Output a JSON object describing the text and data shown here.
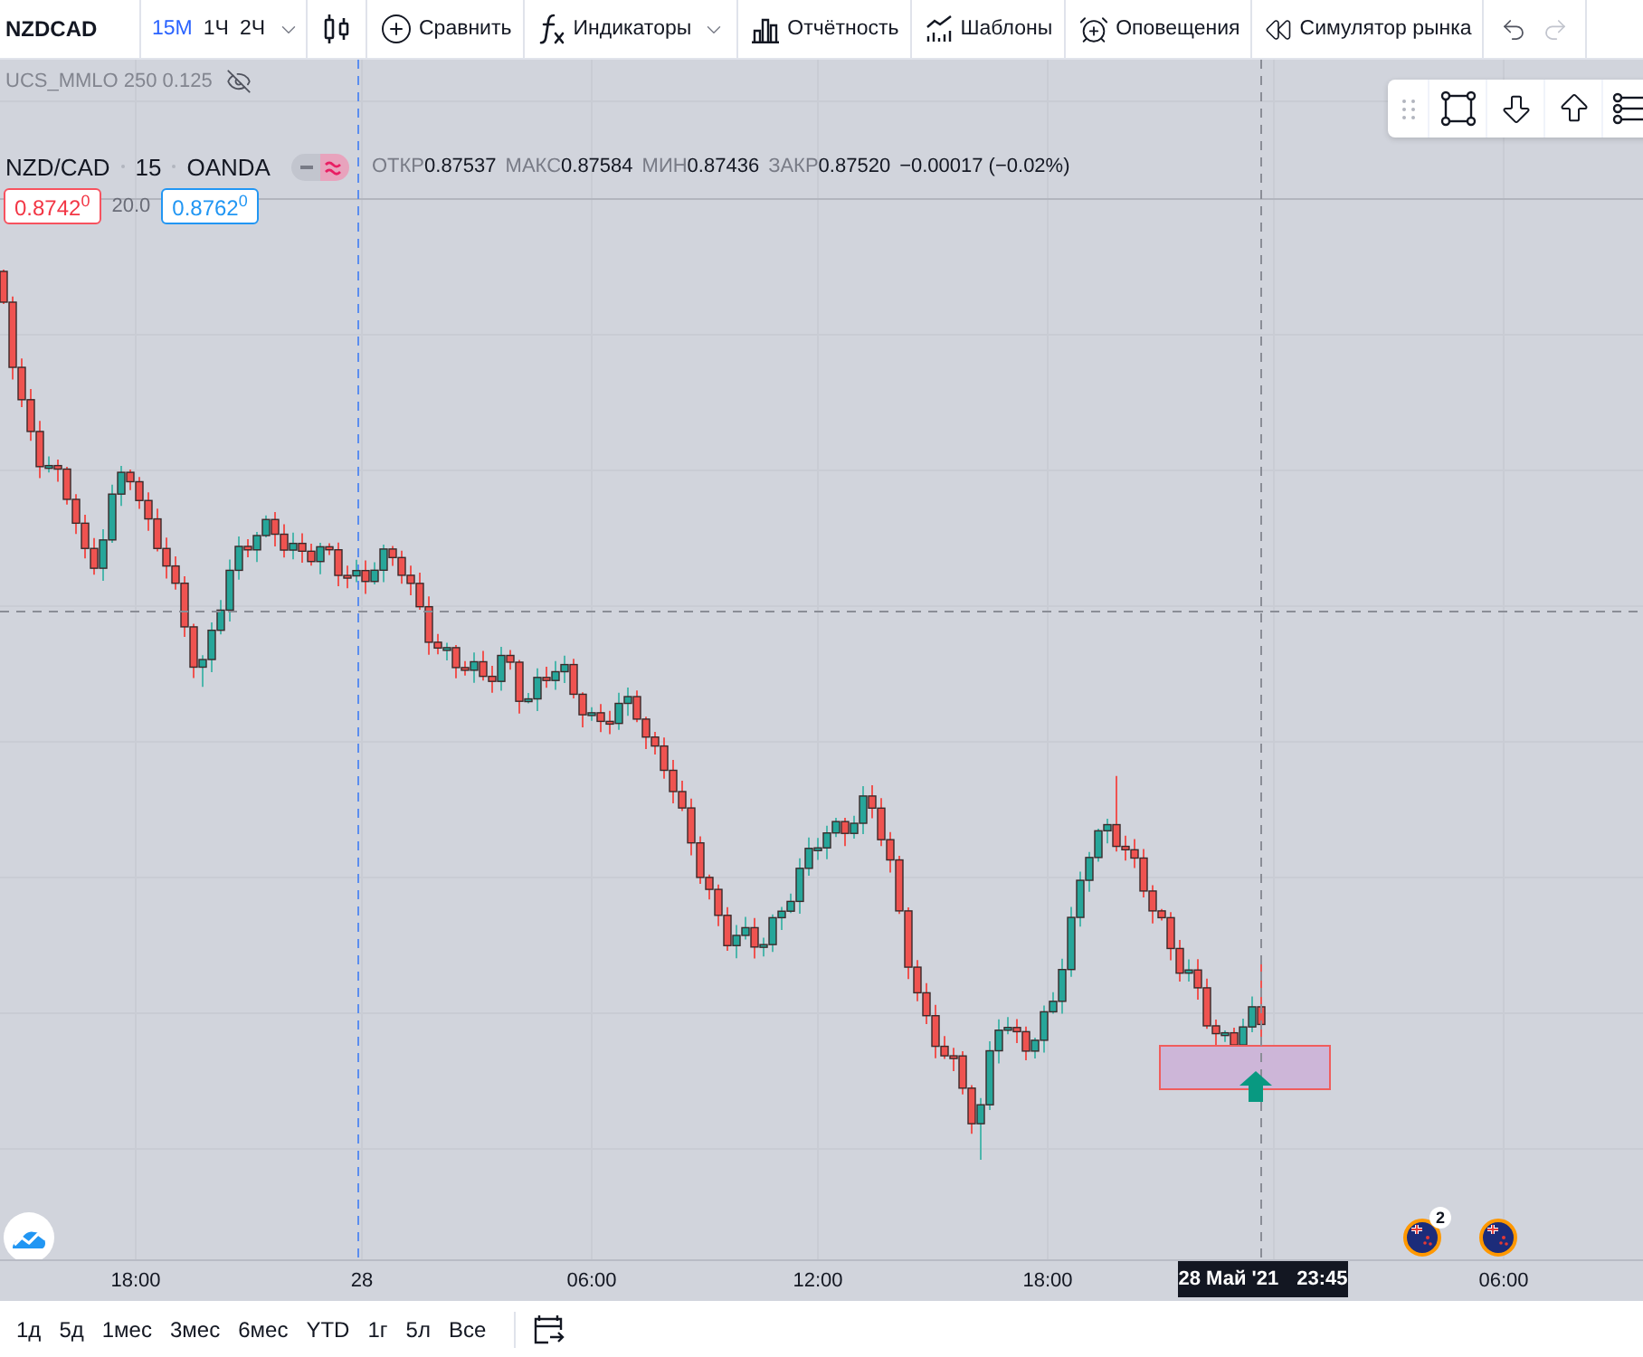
{
  "toolbar": {
    "symbol": "NZDCAD",
    "intervals": [
      {
        "label": "15М",
        "selected": true
      },
      {
        "label": "1Ч",
        "selected": false
      },
      {
        "label": "2Ч",
        "selected": false
      }
    ],
    "buttons": [
      {
        "kind": "compare",
        "label": "Сравнить"
      },
      {
        "kind": "indicators",
        "label": "Индикаторы"
      },
      {
        "kind": "reports",
        "label": "Отчётность"
      },
      {
        "kind": "templates",
        "label": "Шаблоны"
      },
      {
        "kind": "alerts",
        "label": "Оповещения"
      },
      {
        "kind": "replay",
        "label": "Симулятор рынка"
      }
    ],
    "history": [
      {
        "kind": "undo",
        "disabled": false
      },
      {
        "kind": "redo",
        "disabled": true
      }
    ]
  },
  "indicator_pane": {
    "title": "UCS_MMLO 250 0.125",
    "hidden": true
  },
  "legend": {
    "symbol": "NZD/CAD",
    "interval": "15",
    "exchange": "OANDA",
    "ohlc": [
      {
        "label": "ОТКР",
        "value": "0.87537"
      },
      {
        "label": "МАКС",
        "value": "0.87584"
      },
      {
        "label": "МИН",
        "value": "0.87436"
      },
      {
        "label": "ЗАКР",
        "value": "0.87520"
      }
    ],
    "change": "−0.00017 (−0.02%)",
    "sell": "0.8742$^{0}$",
    "spread": "20.0",
    "buy": "0.8762$^{0}$"
  },
  "events": [
    {
      "kind": "grouped",
      "badge": "2"
    },
    {
      "kind": "single"
    }
  ],
  "time_axis": {
    "labels": [
      "18:00",
      "28",
      "06:00",
      "12:00",
      "18:00",
      "06:00"
    ],
    "cursor": {
      "date": "28 Май '21",
      "time": "23:45"
    }
  },
  "ranges": [
    "1д",
    "5д",
    "1мес",
    "3мес",
    "6мес",
    "YTD",
    "1г",
    "5л",
    "Все"
  ]
}
